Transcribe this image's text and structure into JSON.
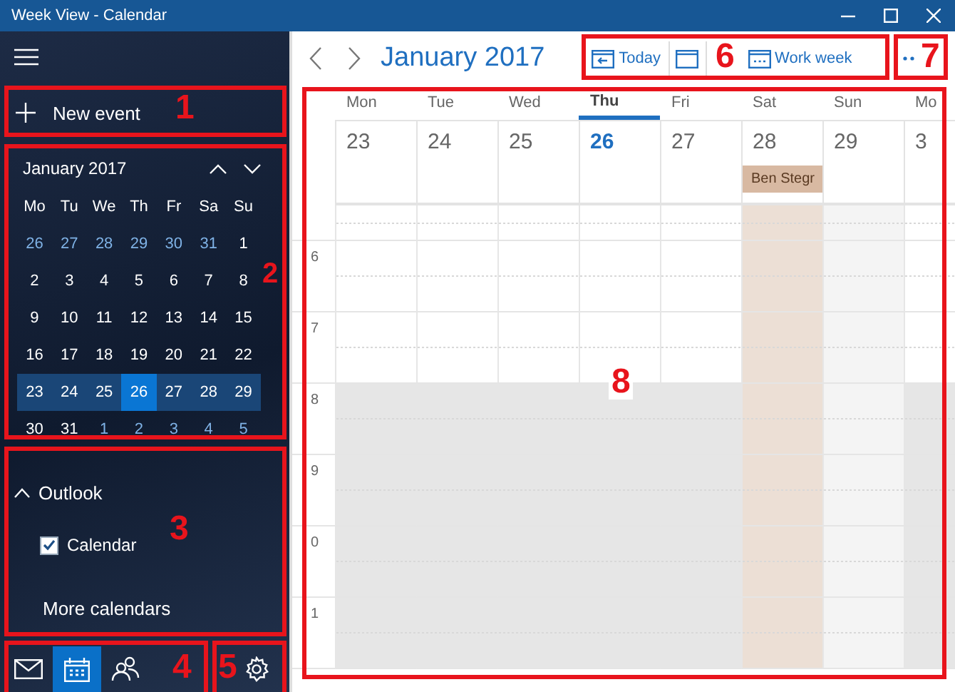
{
  "window": {
    "title": "Week View - Calendar"
  },
  "sidebar": {
    "new_event": "New event",
    "mini_calendar": {
      "title": "January 2017",
      "weekdays": [
        "Mo",
        "Tu",
        "We",
        "Th",
        "Fr",
        "Sa",
        "Su"
      ],
      "weeks": [
        {
          "selected": false,
          "days": [
            {
              "label": "26",
              "in_month": false,
              "today": false
            },
            {
              "label": "27",
              "in_month": false,
              "today": false
            },
            {
              "label": "28",
              "in_month": false,
              "today": false
            },
            {
              "label": "29",
              "in_month": false,
              "today": false
            },
            {
              "label": "30",
              "in_month": false,
              "today": false
            },
            {
              "label": "31",
              "in_month": false,
              "today": false
            },
            {
              "label": "1",
              "in_month": true,
              "today": false
            }
          ]
        },
        {
          "selected": false,
          "days": [
            {
              "label": "2",
              "in_month": true,
              "today": false
            },
            {
              "label": "3",
              "in_month": true,
              "today": false
            },
            {
              "label": "4",
              "in_month": true,
              "today": false
            },
            {
              "label": "5",
              "in_month": true,
              "today": false
            },
            {
              "label": "6",
              "in_month": true,
              "today": false
            },
            {
              "label": "7",
              "in_month": true,
              "today": false
            },
            {
              "label": "8",
              "in_month": true,
              "today": false
            }
          ]
        },
        {
          "selected": false,
          "days": [
            {
              "label": "9",
              "in_month": true,
              "today": false
            },
            {
              "label": "10",
              "in_month": true,
              "today": false
            },
            {
              "label": "11",
              "in_month": true,
              "today": false
            },
            {
              "label": "12",
              "in_month": true,
              "today": false
            },
            {
              "label": "13",
              "in_month": true,
              "today": false
            },
            {
              "label": "14",
              "in_month": true,
              "today": false
            },
            {
              "label": "15",
              "in_month": true,
              "today": false
            }
          ]
        },
        {
          "selected": false,
          "days": [
            {
              "label": "16",
              "in_month": true,
              "today": false
            },
            {
              "label": "17",
              "in_month": true,
              "today": false
            },
            {
              "label": "18",
              "in_month": true,
              "today": false
            },
            {
              "label": "19",
              "in_month": true,
              "today": false
            },
            {
              "label": "20",
              "in_month": true,
              "today": false
            },
            {
              "label": "21",
              "in_month": true,
              "today": false
            },
            {
              "label": "22",
              "in_month": true,
              "today": false
            }
          ]
        },
        {
          "selected": true,
          "days": [
            {
              "label": "23",
              "in_month": true,
              "today": false
            },
            {
              "label": "24",
              "in_month": true,
              "today": false
            },
            {
              "label": "25",
              "in_month": true,
              "today": false
            },
            {
              "label": "26",
              "in_month": true,
              "today": true
            },
            {
              "label": "27",
              "in_month": true,
              "today": false
            },
            {
              "label": "28",
              "in_month": true,
              "today": false
            },
            {
              "label": "29",
              "in_month": true,
              "today": false
            }
          ]
        },
        {
          "selected": false,
          "days": [
            {
              "label": "30",
              "in_month": true,
              "today": false
            },
            {
              "label": "31",
              "in_month": true,
              "today": false
            },
            {
              "label": "1",
              "in_month": false,
              "today": false
            },
            {
              "label": "2",
              "in_month": false,
              "today": false
            },
            {
              "label": "3",
              "in_month": false,
              "today": false
            },
            {
              "label": "4",
              "in_month": false,
              "today": false
            },
            {
              "label": "5",
              "in_month": false,
              "today": false
            }
          ]
        }
      ]
    },
    "accounts": [
      {
        "name": "Outlook",
        "expanded": true,
        "calendars": [
          {
            "name": "Calendar",
            "checked": true
          }
        ]
      }
    ],
    "more_calendars": "More calendars",
    "nav": [
      {
        "kind": "mail",
        "selected": false
      },
      {
        "kind": "calendar",
        "selected": true
      },
      {
        "kind": "people",
        "selected": false
      },
      {
        "kind": "settings",
        "selected": false
      }
    ]
  },
  "header": {
    "title": "January 2017",
    "toolbar": [
      {
        "kind": "today",
        "label": "Today"
      },
      {
        "kind": "day"
      },
      {
        "kind": "work_week",
        "label": "Work week"
      }
    ]
  },
  "week": {
    "columns": [
      {
        "weekday": "Mon",
        "date": "23",
        "today": false,
        "kind": "weekday"
      },
      {
        "weekday": "Tue",
        "date": "24",
        "today": false,
        "kind": "weekday"
      },
      {
        "weekday": "Wed",
        "date": "25",
        "today": false,
        "kind": "weekday"
      },
      {
        "weekday": "Thu",
        "date": "26",
        "today": true,
        "kind": "weekday"
      },
      {
        "weekday": "Fri",
        "date": "27",
        "today": false,
        "kind": "weekday"
      },
      {
        "weekday": "Sat",
        "date": "28",
        "today": false,
        "kind": "busy",
        "event": "Ben Stegr"
      },
      {
        "weekday": "Sun",
        "date": "29",
        "today": false,
        "kind": "weekend"
      },
      {
        "weekday": "Mo",
        "date": "3",
        "today": false,
        "kind": "weekday"
      }
    ],
    "hours": [
      {
        "label": "6",
        "shaded": false
      },
      {
        "label": "7",
        "shaded": false
      },
      {
        "label": "8",
        "shaded": true
      },
      {
        "label": "9",
        "shaded": true
      },
      {
        "label": "0",
        "shaded": true
      },
      {
        "label": "1",
        "shaded": true
      }
    ]
  },
  "annotations": [
    {
      "label": "1"
    },
    {
      "label": "2"
    },
    {
      "label": "3"
    },
    {
      "label": "4"
    },
    {
      "label": "5"
    },
    {
      "label": "6"
    },
    {
      "label": "7"
    },
    {
      "label": "8"
    }
  ]
}
